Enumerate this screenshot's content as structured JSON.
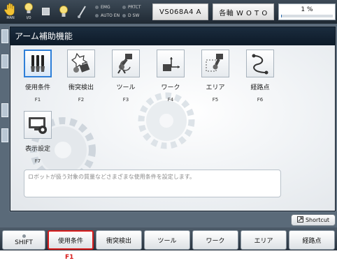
{
  "statusbar": {
    "man_label": "MAN",
    "io_label": "I/O",
    "lamps": [
      {
        "label": "EMG"
      },
      {
        "label": "PRTCT"
      },
      {
        "label": "AUTO EN"
      },
      {
        "label": "D SW"
      }
    ],
    "robot_label": "VS068A4 A",
    "axis_label": "各軸  W O T O",
    "speed_text": "1 %",
    "speed_fraction": 0.01,
    "colors": {
      "accent": "#2e7fd8",
      "highlight": "#d81c1c",
      "titlebar": "#0d1a28"
    }
  },
  "dialog": {
    "title": "アーム補助機能",
    "items": [
      {
        "label": "使用条件",
        "key": "F1",
        "icon": "grippers-icon",
        "selected": true
      },
      {
        "label": "衝突検出",
        "key": "F2",
        "icon": "collision-icon",
        "selected": false
      },
      {
        "label": "ツール",
        "key": "F3",
        "icon": "tool-icon",
        "selected": false
      },
      {
        "label": "ワーク",
        "key": "F4",
        "icon": "work-icon",
        "selected": false
      },
      {
        "label": "エリア",
        "key": "F5",
        "icon": "area-icon",
        "selected": false
      },
      {
        "label": "経路点",
        "key": "F6",
        "icon": "path-point-icon",
        "selected": false
      },
      {
        "label": "表示設定",
        "key": "F7",
        "icon": "display-settings-icon",
        "selected": false
      }
    ],
    "description": "ロボットが扱う対象の質量などさまざまな使用条件を設定します。"
  },
  "shortcut": {
    "label": "Shortcut"
  },
  "fkeys": {
    "shift": "SHIFT",
    "keys": [
      "使用条件",
      "衝突検出",
      "ツール",
      "ワーク",
      "エリア",
      "経路点"
    ]
  },
  "callout": {
    "label": "F1"
  }
}
